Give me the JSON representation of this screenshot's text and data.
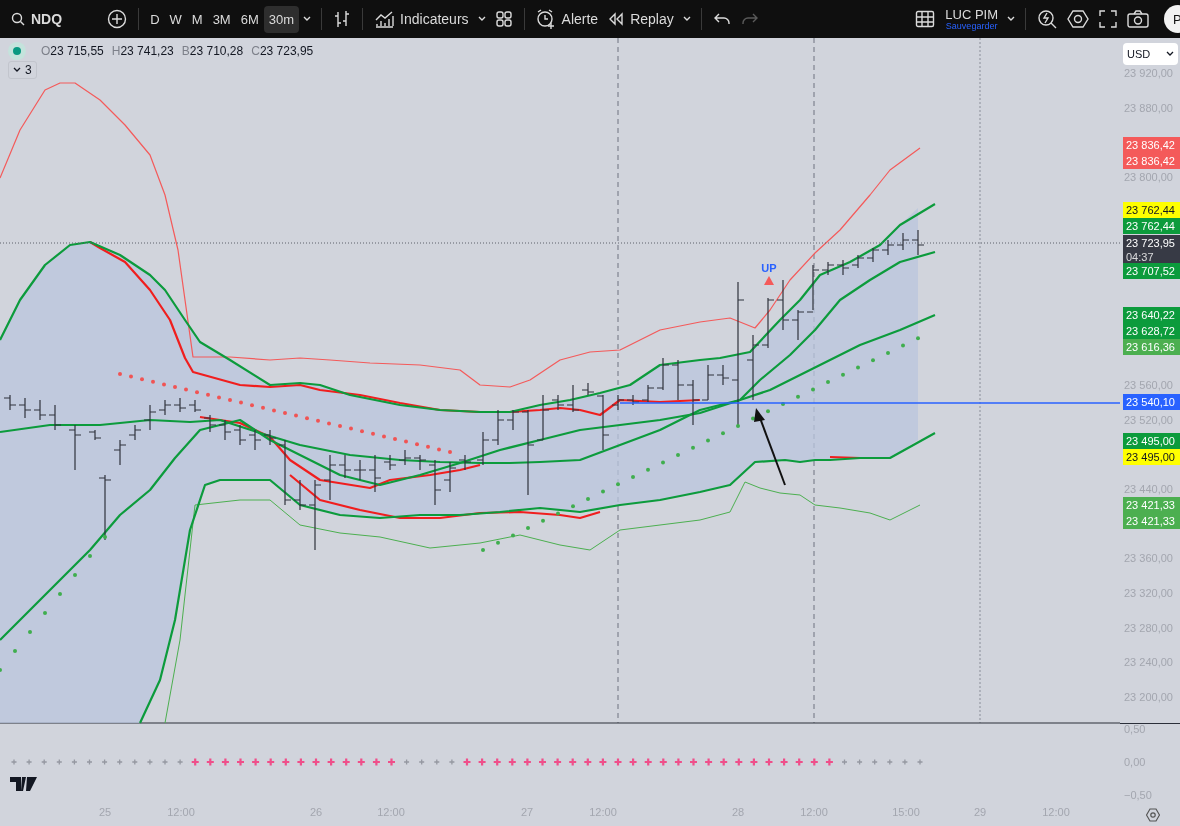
{
  "toolbar": {
    "symbol": "NDQ",
    "intervals": [
      {
        "label": "D",
        "selected": false
      },
      {
        "label": "W",
        "selected": false
      },
      {
        "label": "M",
        "selected": false
      },
      {
        "label": "3M",
        "selected": false
      },
      {
        "label": "6M",
        "selected": false
      },
      {
        "label": "30m",
        "selected": true
      }
    ],
    "indicators_label": "Indicateurs",
    "alert_label": "Alerte",
    "replay_label": "Replay",
    "redo_disabled": true,
    "layout_name": "LUC PIM",
    "save_label": "Sauvegarder",
    "avatar_letter": "P"
  },
  "legend": {
    "status_dot": {
      "color": "#089981"
    },
    "values": [
      {
        "label": "O",
        "value": "23 715,55"
      },
      {
        "label": "H",
        "value": "23 741,23"
      },
      {
        "label": "B",
        "value": "23 710,28"
      },
      {
        "label": "C",
        "value": "23 723,95"
      }
    ],
    "indicator_count": "3"
  },
  "chart": {
    "signal_label": "UP"
  },
  "price_axis": {
    "currency": "USD",
    "ticks": [
      "23 920,00",
      "23 880,00",
      "23 800,00",
      "23 560,00",
      "23 520,00",
      "23 440,00",
      "23 360,00",
      "23 320,00",
      "23 280,00",
      "23 240,00",
      "23 200,00"
    ],
    "tags": [
      {
        "value": "23 836,42",
        "color": "#f45a5a"
      },
      {
        "value": "23 836,42",
        "color": "#f45a5a"
      },
      {
        "value": "23 762,44",
        "color": "#ffff00"
      },
      {
        "value": "23 762,44",
        "color": "#0c9b3c"
      },
      {
        "value": "23 723,95",
        "color": "#373a45",
        "countdown": "04:37"
      },
      {
        "value": "23 707,52",
        "color": "#0c9b3c"
      },
      {
        "value": "23 640,22",
        "color": "#0c9b3c"
      },
      {
        "value": "23 628,72",
        "color": "#0c9b3c"
      },
      {
        "value": "23 616,36",
        "color": "#4caf50"
      },
      {
        "value": "23 540,10",
        "color": "#2962ff"
      },
      {
        "value": "23 495,00",
        "color": "#0c9b3c"
      },
      {
        "value": "23 495,00",
        "color": "#ffff00"
      },
      {
        "value": "23 421,33",
        "color": "#4caf50"
      },
      {
        "value": "23 421,33",
        "color": "#4caf50"
      }
    ],
    "lower_ticks": [
      "0,50",
      "0,00",
      "−0,50"
    ]
  },
  "time_axis": {
    "labels": [
      "25",
      "12:00",
      "26",
      "12:00",
      "27",
      "12:00",
      "28",
      "12:00",
      "15:00",
      "29",
      "12:00"
    ]
  }
}
